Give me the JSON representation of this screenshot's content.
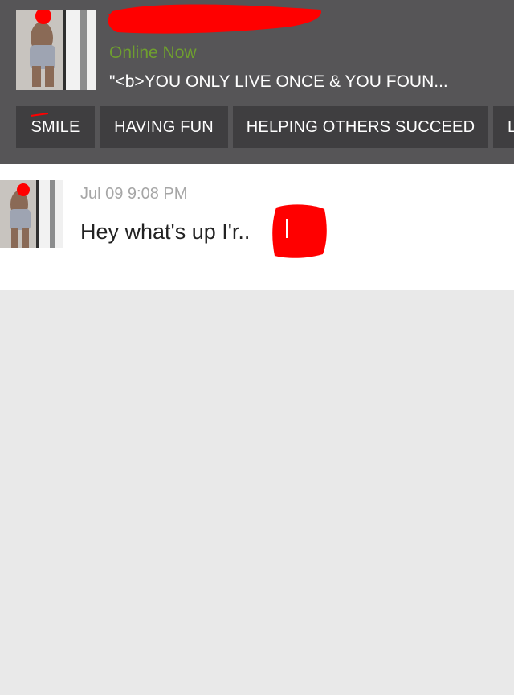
{
  "profile": {
    "status": "Online Now",
    "headline": "\"<b>YOU ONLY LIVE ONCE & YOU FOUN..."
  },
  "tags": [
    "SMILE",
    "HAVING FUN",
    "HELPING OTHERS SUCCEED",
    "L"
  ],
  "message": {
    "timestamp": "Jul 09 9:08 PM",
    "text": "Hey what's up I'r.."
  },
  "colors": {
    "header_bg": "#565557",
    "tag_bg": "#3f3e40",
    "online_green": "#6f9f2f",
    "redaction_red": "#ff0000",
    "body_bg": "#e9e9e9"
  }
}
